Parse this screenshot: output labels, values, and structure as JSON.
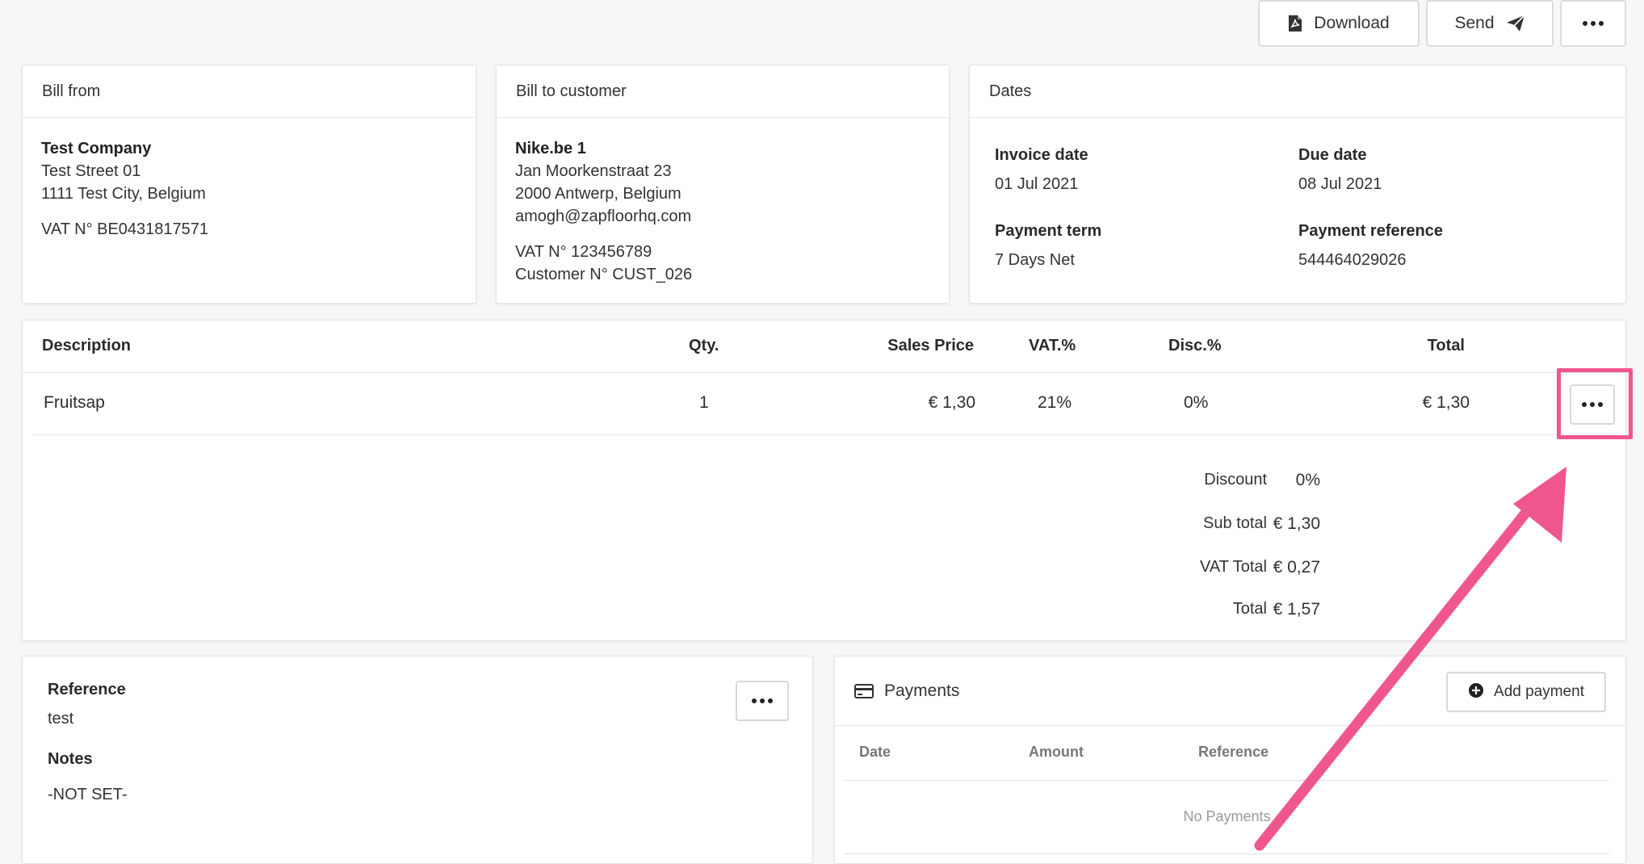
{
  "toolbar": {
    "download_label": "Download",
    "send_label": "Send",
    "more_icon": "more-dots-icon",
    "download_icon": "pdf-file-icon",
    "send_icon": "paper-plane-icon"
  },
  "bill_from": {
    "title": "Bill from",
    "company": "Test Company",
    "street": "Test Street 01",
    "city": "1111 Test City, Belgium",
    "vat": "VAT N° BE0431817571"
  },
  "bill_to": {
    "title": "Bill to customer",
    "name": "Nike.be 1",
    "street": "Jan Moorkenstraat 23",
    "city": "2000 Antwerp, Belgium",
    "email": "amogh@zapfloorhq.com",
    "vat": "VAT N° 123456789",
    "customer_no": "Customer N° CUST_026"
  },
  "dates": {
    "title": "Dates",
    "invoice_date_label": "Invoice date",
    "invoice_date": "01 Jul 2021",
    "due_date_label": "Due date",
    "due_date": "08 Jul 2021",
    "payment_term_label": "Payment term",
    "payment_term": "7 Days Net",
    "payment_reference_label": "Payment reference",
    "payment_reference": "544464029026"
  },
  "lines": {
    "headers": {
      "description": "Description",
      "qty": "Qty.",
      "sales_price": "Sales Price",
      "vat": "VAT.%",
      "disc": "Disc.%",
      "total": "Total"
    },
    "rows": [
      {
        "description": "Fruitsap",
        "qty": "1",
        "sales_price": "€ 1,30",
        "vat": "21%",
        "disc": "0%",
        "total": "€ 1,30"
      }
    ]
  },
  "totals": {
    "discount_label": "Discount",
    "discount": "0%",
    "subtotal_label": "Sub total",
    "subtotal": "€ 1,30",
    "vat_total_label": "VAT Total",
    "vat_total": "€ 0,27",
    "total_label": "Total",
    "total": "€ 1,57"
  },
  "reference": {
    "reference_label": "Reference",
    "reference": "test",
    "notes_label": "Notes",
    "notes": "-NOT SET-"
  },
  "payments": {
    "title": "Payments",
    "add_label": "Add payment",
    "columns": [
      "Date",
      "Amount",
      "Reference"
    ],
    "empty": "No Payments",
    "icon": "credit-card-icon"
  },
  "colors": {
    "highlight": "#f0568e",
    "background": "#f7f7f7"
  }
}
